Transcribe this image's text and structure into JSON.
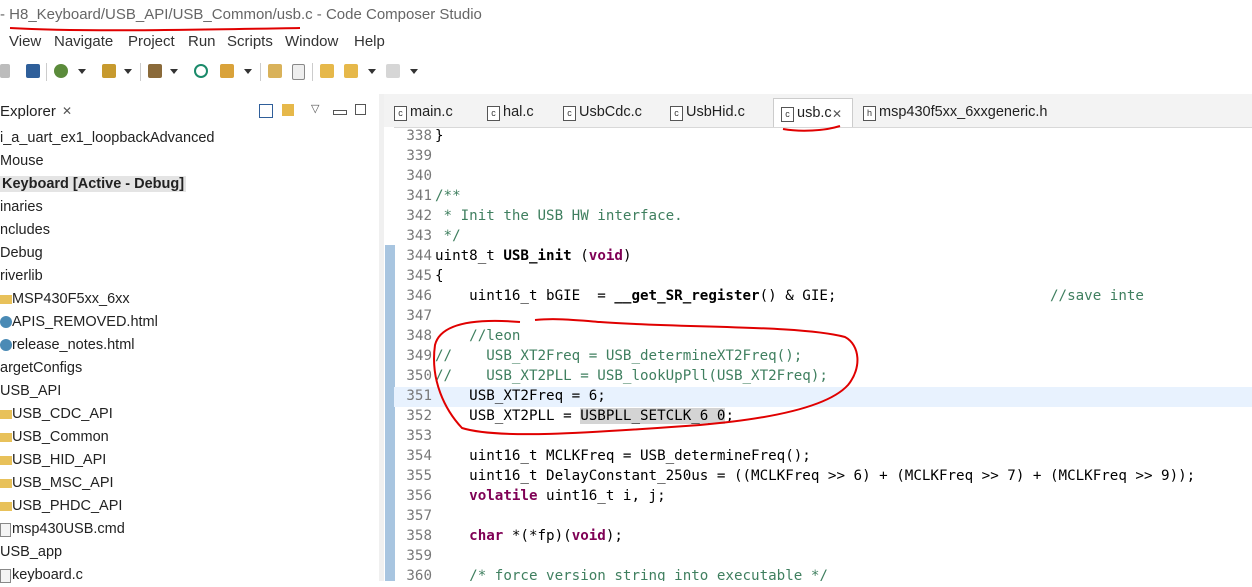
{
  "window": {
    "title": "- H8_Keyboard/USB_API/USB_Common/usb.c - Code Composer Studio"
  },
  "menu": [
    "View",
    "Navigate",
    "Project",
    "Run",
    "Scripts",
    "Window",
    "Help"
  ],
  "explorer": {
    "title": "Explorer",
    "items": [
      {
        "label": "i_a_uart_ex1_loopbackAdvanced",
        "icon": "none"
      },
      {
        "label": "Mouse",
        "icon": "none"
      },
      {
        "label": "Keyboard  [Active - Debug]",
        "icon": "none",
        "bold": true
      },
      {
        "label": "inaries",
        "icon": "none"
      },
      {
        "label": "ncludes",
        "icon": "none"
      },
      {
        "label": "Debug",
        "icon": "none"
      },
      {
        "label": "riverlib",
        "icon": "none"
      },
      {
        "label": "MSP430F5xx_6xx",
        "icon": "folder-icon"
      },
      {
        "label": "APIS_REMOVED.html",
        "icon": "html-file-icon"
      },
      {
        "label": "release_notes.html",
        "icon": "html-file-icon"
      },
      {
        "label": "argetConfigs",
        "icon": "none"
      },
      {
        "label": "USB_API",
        "icon": "none"
      },
      {
        "label": "USB_CDC_API",
        "icon": "folder-icon"
      },
      {
        "label": "USB_Common",
        "icon": "folder-icon"
      },
      {
        "label": "USB_HID_API",
        "icon": "folder-icon"
      },
      {
        "label": "USB_MSC_API",
        "icon": "folder-icon"
      },
      {
        "label": "USB_PHDC_API",
        "icon": "folder-icon"
      },
      {
        "label": "msp430USB.cmd",
        "icon": "file-icon"
      },
      {
        "label": "USB_app",
        "icon": "none"
      },
      {
        "label": "keyboard.c",
        "icon": "file-icon"
      }
    ]
  },
  "editor": {
    "tabs": [
      {
        "label": "main.c",
        "icon": "c-file-icon",
        "active": false
      },
      {
        "label": "hal.c",
        "icon": "c-file-icon",
        "active": false
      },
      {
        "label": "UsbCdc.c",
        "icon": "c-file-icon",
        "active": false
      },
      {
        "label": "UsbHid.c",
        "icon": "c-file-icon",
        "active": false
      },
      {
        "label": "usb.c",
        "icon": "c-file-icon",
        "active": true
      },
      {
        "label": "msp430f5xx_6xxgeneric.h",
        "icon": "h-file-icon",
        "active": false
      }
    ],
    "lines": [
      {
        "n": "338",
        "text": "}"
      },
      {
        "n": "339",
        "text": ""
      },
      {
        "n": "340",
        "text": ""
      },
      {
        "n": "341",
        "text": "/**"
      },
      {
        "n": "342",
        "text": " * Init the USB HW interface."
      },
      {
        "n": "343",
        "text": " */"
      },
      {
        "n": "344",
        "text": "uint8_t USB_init (void)"
      },
      {
        "n": "345",
        "text": "{"
      },
      {
        "n": "346",
        "text": "    uint16_t bGIE  = __get_SR_register() & GIE;                         //save inte"
      },
      {
        "n": "347",
        "text": ""
      },
      {
        "n": "348",
        "text": "    //leon"
      },
      {
        "n": "349",
        "text": "//    USB_XT2Freq = USB_determineXT2Freq();"
      },
      {
        "n": "350",
        "text": "//    USB_XT2PLL = USB_lookUpPll(USB_XT2Freq);"
      },
      {
        "n": "351",
        "text": "    USB_XT2Freq = 6;"
      },
      {
        "n": "352",
        "text": "    USB_XT2PLL = USBPLL_SETCLK_6_0;"
      },
      {
        "n": "353",
        "text": ""
      },
      {
        "n": "354",
        "text": "    uint16_t MCLKFreq = USB_determineFreq();"
      },
      {
        "n": "355",
        "text": "    uint16_t DelayConstant_250us = ((MCLKFreq >> 6) + (MCLKFreq >> 7) + (MCLKFreq >> 9));"
      },
      {
        "n": "356",
        "text": "    volatile uint16_t i, j;"
      },
      {
        "n": "357",
        "text": ""
      },
      {
        "n": "358",
        "text": "    char *(*fp)(void);"
      },
      {
        "n": "359",
        "text": ""
      },
      {
        "n": "360",
        "text": "    /* force version string into executable */"
      }
    ]
  },
  "colors": {
    "keyword": "#7f0055",
    "comment": "#3f7f5f",
    "annotation": "#e00000",
    "current_line": "#e8f2fe"
  }
}
